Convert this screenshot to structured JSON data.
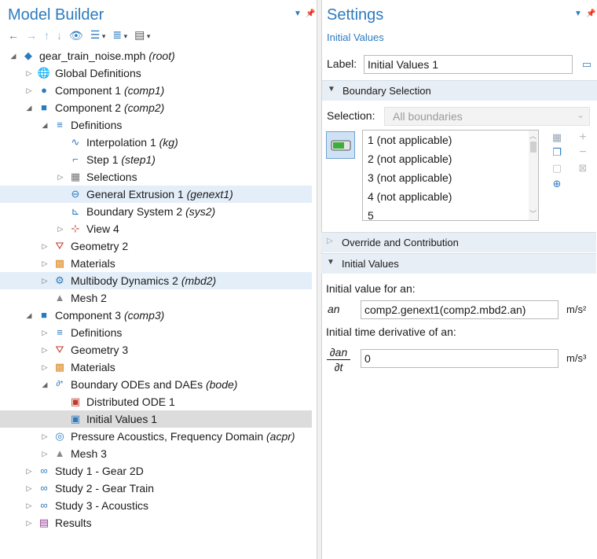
{
  "model_builder": {
    "title": "Model Builder",
    "toolbar": [
      "back-arrow-icon",
      "forward-arrow-icon",
      "up-arrow-icon",
      "down-arrow-icon",
      "show-icon",
      "collapse-icon",
      "expand-icon",
      "list-icon"
    ],
    "tree": [
      {
        "label": "gear_train_noise.mph",
        "tag": "(root)"
      },
      {
        "label": "Global Definitions",
        "tag": ""
      },
      {
        "label": "Component 1",
        "tag": "(comp1)"
      },
      {
        "label": "Component 2",
        "tag": "(comp2)"
      },
      {
        "label": "Definitions",
        "tag": ""
      },
      {
        "label": "Interpolation 1",
        "tag": "(kg)"
      },
      {
        "label": "Step 1",
        "tag": "(step1)"
      },
      {
        "label": "Selections",
        "tag": ""
      },
      {
        "label": "General Extrusion 1",
        "tag": "(genext1)"
      },
      {
        "label": "Boundary System 2",
        "tag": "(sys2)"
      },
      {
        "label": "View 4",
        "tag": ""
      },
      {
        "label": "Geometry 2",
        "tag": ""
      },
      {
        "label": "Materials",
        "tag": ""
      },
      {
        "label": "Multibody Dynamics 2",
        "tag": "(mbd2)"
      },
      {
        "label": "Mesh 2",
        "tag": ""
      },
      {
        "label": "Component 3",
        "tag": "(comp3)"
      },
      {
        "label": "Definitions",
        "tag": ""
      },
      {
        "label": "Geometry 3",
        "tag": ""
      },
      {
        "label": "Materials",
        "tag": ""
      },
      {
        "label": "Boundary ODEs and DAEs",
        "tag": "(bode)"
      },
      {
        "label": "Distributed ODE 1",
        "tag": ""
      },
      {
        "label": "Initial Values 1",
        "tag": ""
      },
      {
        "label": "Pressure Acoustics, Frequency Domain",
        "tag": "(acpr)"
      },
      {
        "label": "Mesh 3",
        "tag": ""
      },
      {
        "label": "Study 1 - Gear 2D",
        "tag": ""
      },
      {
        "label": "Study 2 - Gear Train",
        "tag": ""
      },
      {
        "label": "Study 3 - Acoustics",
        "tag": ""
      },
      {
        "label": "Results",
        "tag": ""
      }
    ]
  },
  "settings": {
    "title": "Settings",
    "subtitle": "Initial Values",
    "label_caption": "Label:",
    "label_value": "Initial Values 1",
    "sections": {
      "boundary_selection": "Boundary Selection",
      "override": "Override and Contribution",
      "initial_values": "Initial Values"
    },
    "selection_caption": "Selection:",
    "selection_value": "All boundaries",
    "boundaries": [
      "1 (not applicable)",
      "2 (not applicable)",
      "3 (not applicable)",
      "4 (not applicable)",
      "5"
    ],
    "initial_value_caption": "Initial value for an:",
    "var_name": "an",
    "initial_value": "comp2.genext1(comp2.mbd2.an)",
    "unit_value": "m/s²",
    "derivative_caption": "Initial time derivative of an:",
    "deriv_num": "∂an",
    "deriv_den": "∂t",
    "derivative_value": "0",
    "unit_derivative": "m/s³"
  },
  "colors": {
    "accent": "#2d7bbf",
    "highlight_light": "#e3eef9",
    "highlight_gray": "#dcdcdc",
    "section_bg": "#e8eef5"
  }
}
